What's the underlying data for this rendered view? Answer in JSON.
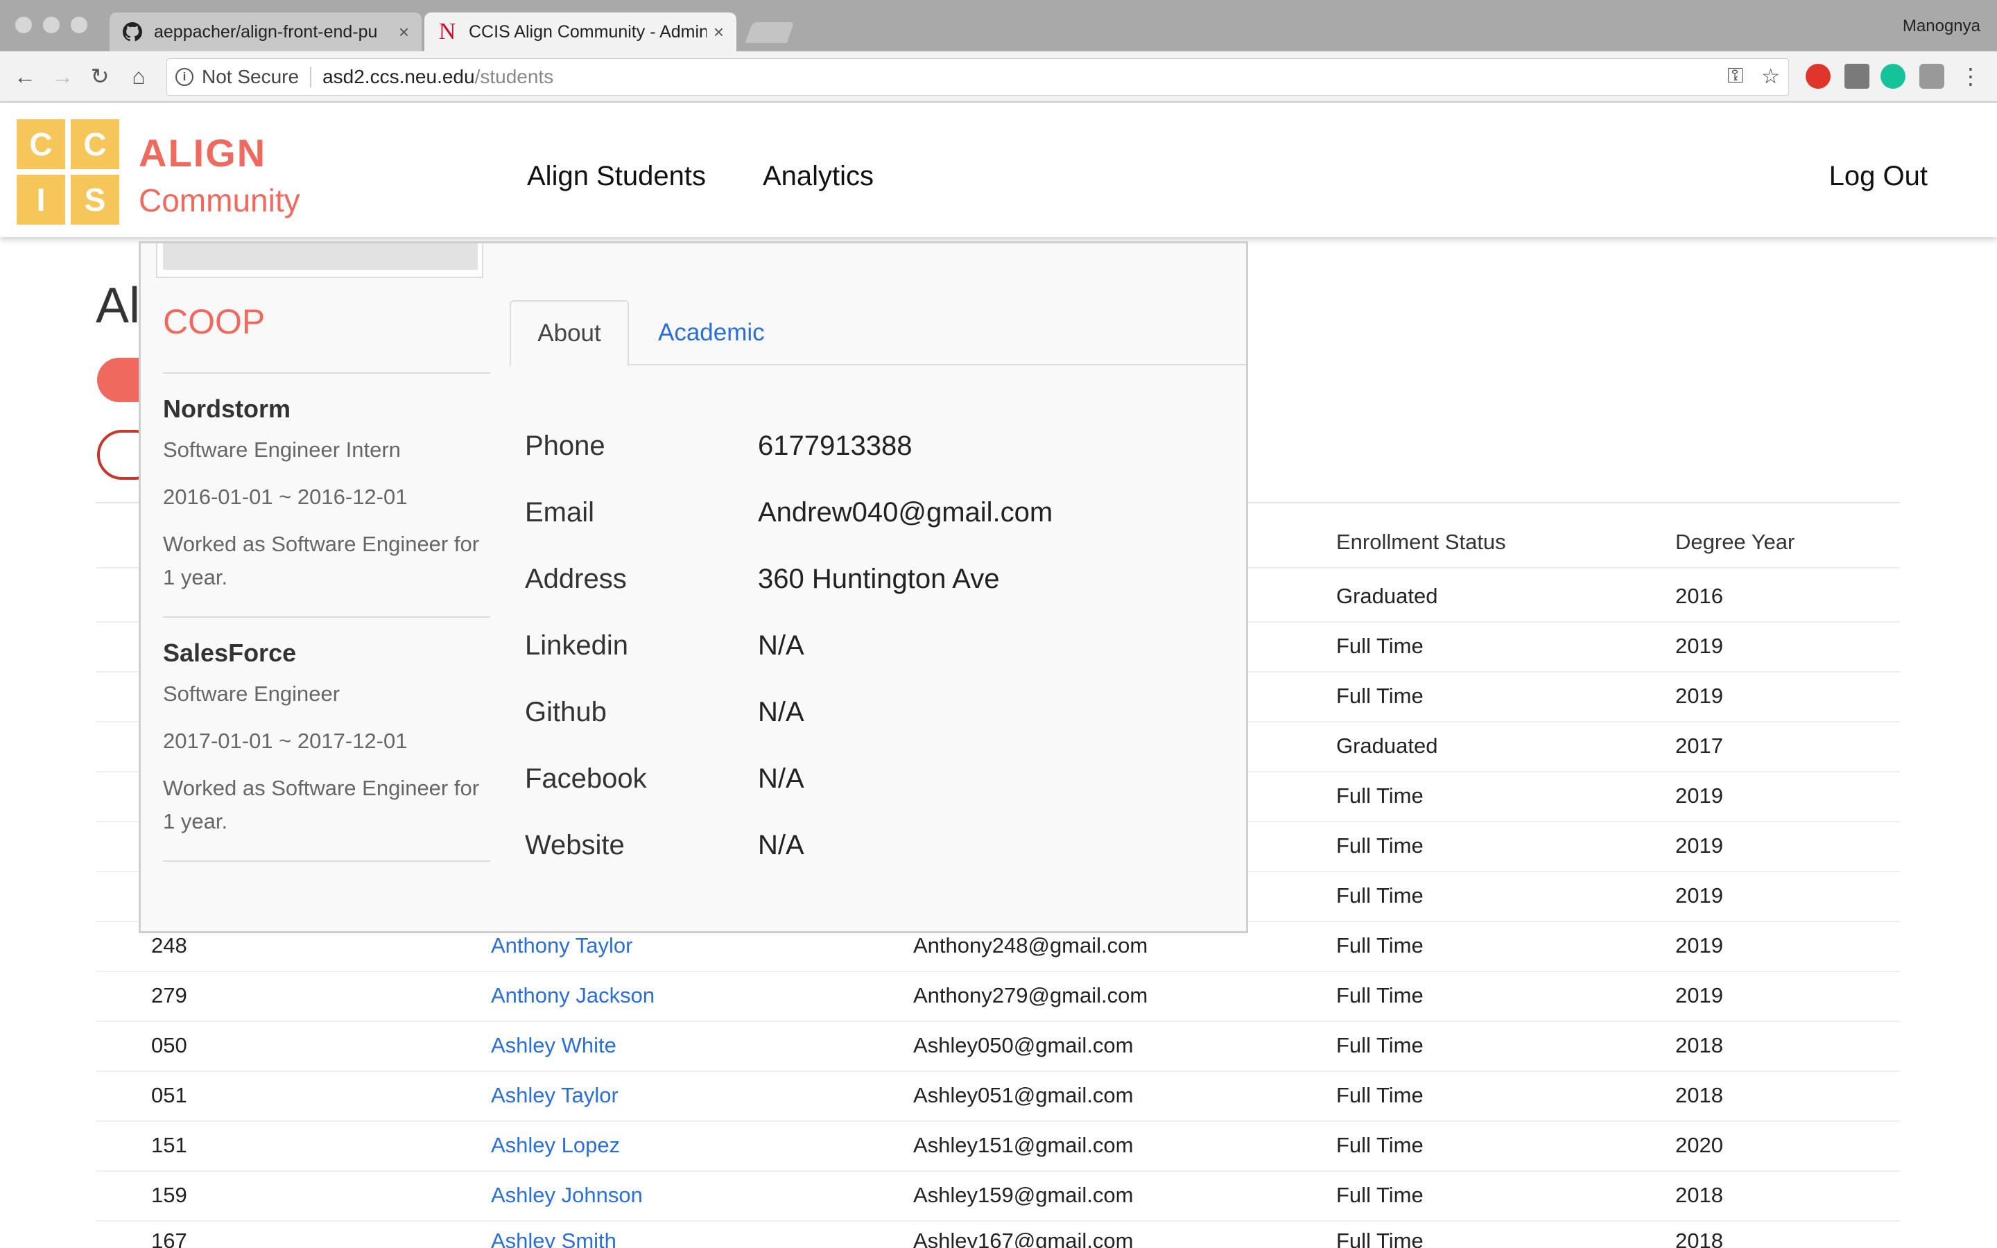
{
  "browser": {
    "tabs": [
      {
        "title": "aeppacher/align-front-end-pu",
        "icon": "github-icon"
      },
      {
        "title": "CCIS Align Community - Admin",
        "icon": "northeastern-n-icon"
      }
    ],
    "profile": "Manognya",
    "security_label": "Not Secure",
    "url_host": "asd2.ccs.neu.edu",
    "url_path": "/students"
  },
  "header": {
    "logo_letters": [
      "C",
      "C",
      "I",
      "S"
    ],
    "brand_title": "ALIGN",
    "brand_subtitle": "Community",
    "nav": [
      "Align Students",
      "Analytics"
    ],
    "logout": "Log Out",
    "brand_color": "#ef6a5e",
    "logo_color": "#f6c65b"
  },
  "page": {
    "title_partial": "Al",
    "table": {
      "headers": [
        "Enrollment Status",
        "Degree Year"
      ],
      "covered_rows": [
        {
          "status": "Graduated",
          "year": "2016"
        },
        {
          "status": "Full Time",
          "year": "2019"
        },
        {
          "status": "Full Time",
          "year": "2019"
        },
        {
          "status": "Graduated",
          "year": "2017"
        },
        {
          "status": "Full Time",
          "year": "2019"
        },
        {
          "status": "Full Time",
          "year": "2019"
        },
        {
          "status": "Full Time",
          "year": "2019"
        }
      ],
      "rows": [
        {
          "id": "248",
          "name": "Anthony Taylor",
          "email": "Anthony248@gmail.com",
          "status": "Full Time",
          "year": "2019"
        },
        {
          "id": "279",
          "name": "Anthony Jackson",
          "email": "Anthony279@gmail.com",
          "status": "Full Time",
          "year": "2019"
        },
        {
          "id": "050",
          "name": "Ashley White",
          "email": "Ashley050@gmail.com",
          "status": "Full Time",
          "year": "2018"
        },
        {
          "id": "051",
          "name": "Ashley Taylor",
          "email": "Ashley051@gmail.com",
          "status": "Full Time",
          "year": "2018"
        },
        {
          "id": "151",
          "name": "Ashley Lopez",
          "email": "Ashley151@gmail.com",
          "status": "Full Time",
          "year": "2020"
        },
        {
          "id": "159",
          "name": "Ashley Johnson",
          "email": "Ashley159@gmail.com",
          "status": "Full Time",
          "year": "2018"
        },
        {
          "id": "167",
          "name": "Ashley Smith",
          "email": "Ashley167@gmail.com",
          "status": "Full Time",
          "year": "2018"
        }
      ]
    }
  },
  "popup": {
    "coop_title": "COOP",
    "jobs": [
      {
        "company": "Nordstorm",
        "role": "Software Engineer Intern",
        "dates": "2016-01-01 ~ 2016-12-01",
        "description": "Worked as Software Engineer for 1 year."
      },
      {
        "company": "SalesForce",
        "role": "Software Engineer",
        "dates": "2017-01-01 ~ 2017-12-01",
        "description": "Worked as Software Engineer for 1 year."
      }
    ],
    "tabs": [
      "About",
      "Academic"
    ],
    "about": [
      {
        "label": "Phone",
        "value": "6177913388"
      },
      {
        "label": "Email",
        "value": "Andrew040@gmail.com"
      },
      {
        "label": "Address",
        "value": "360 Huntington Ave"
      },
      {
        "label": "Linkedin",
        "value": "N/A"
      },
      {
        "label": "Github",
        "value": "N/A"
      },
      {
        "label": "Facebook",
        "value": "N/A"
      },
      {
        "label": "Website",
        "value": "N/A"
      }
    ]
  }
}
